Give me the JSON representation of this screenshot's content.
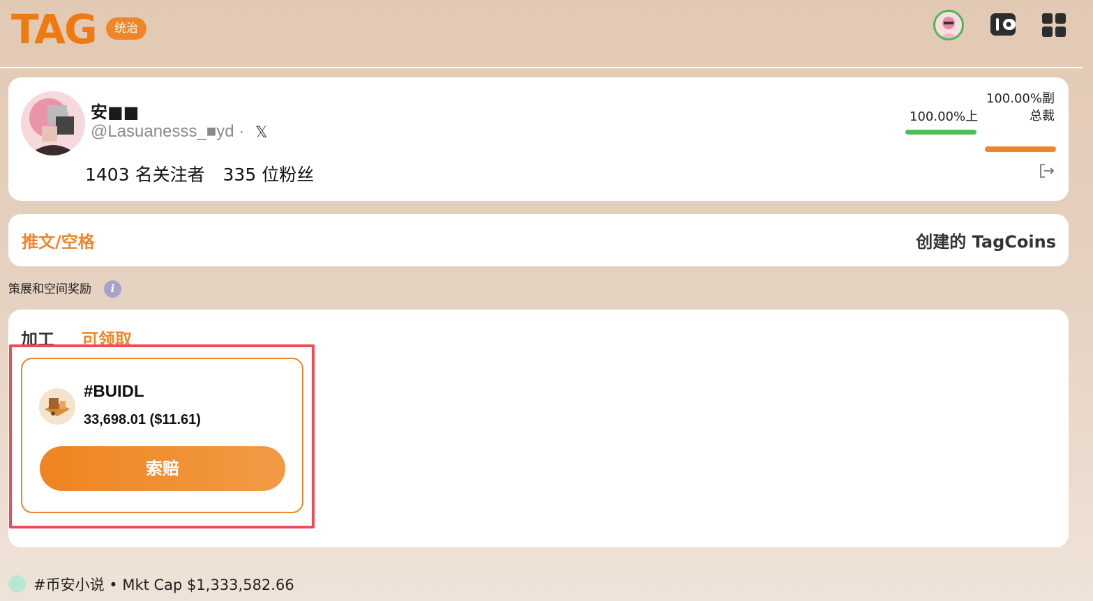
{
  "header": {
    "logo_text": "TAG",
    "governance_badge": "统治"
  },
  "profile": {
    "name": "安■■",
    "handle": "@Lasuanesss_■yd ·",
    "x_icon": "𝕏",
    "following": "1403 名关注者",
    "followers": "335 位粉丝",
    "stat_upper": "100.00%上",
    "stat_vice": "100.00%副总裁",
    "upper_progress": 1.0,
    "vice_progress": 1.0
  },
  "tabs": {
    "tweets": "推文/空格",
    "created": "创建的 TagCoins"
  },
  "section": {
    "label": "策展和空间奖励",
    "info_icon": "i"
  },
  "rewards": {
    "subtab_processing": "加工",
    "subtab_claimable": "可领取",
    "coin": {
      "name": "#BUIDL",
      "amount": "33,698.01 ($11.61)",
      "claim_label": "索赔"
    }
  },
  "ticker": {
    "text": "#币安小说 • Mkt Cap $1,333,582.66"
  },
  "colors": {
    "accent": "#f0862a",
    "green": "#4cc058",
    "highlight": "#ef4a58"
  }
}
